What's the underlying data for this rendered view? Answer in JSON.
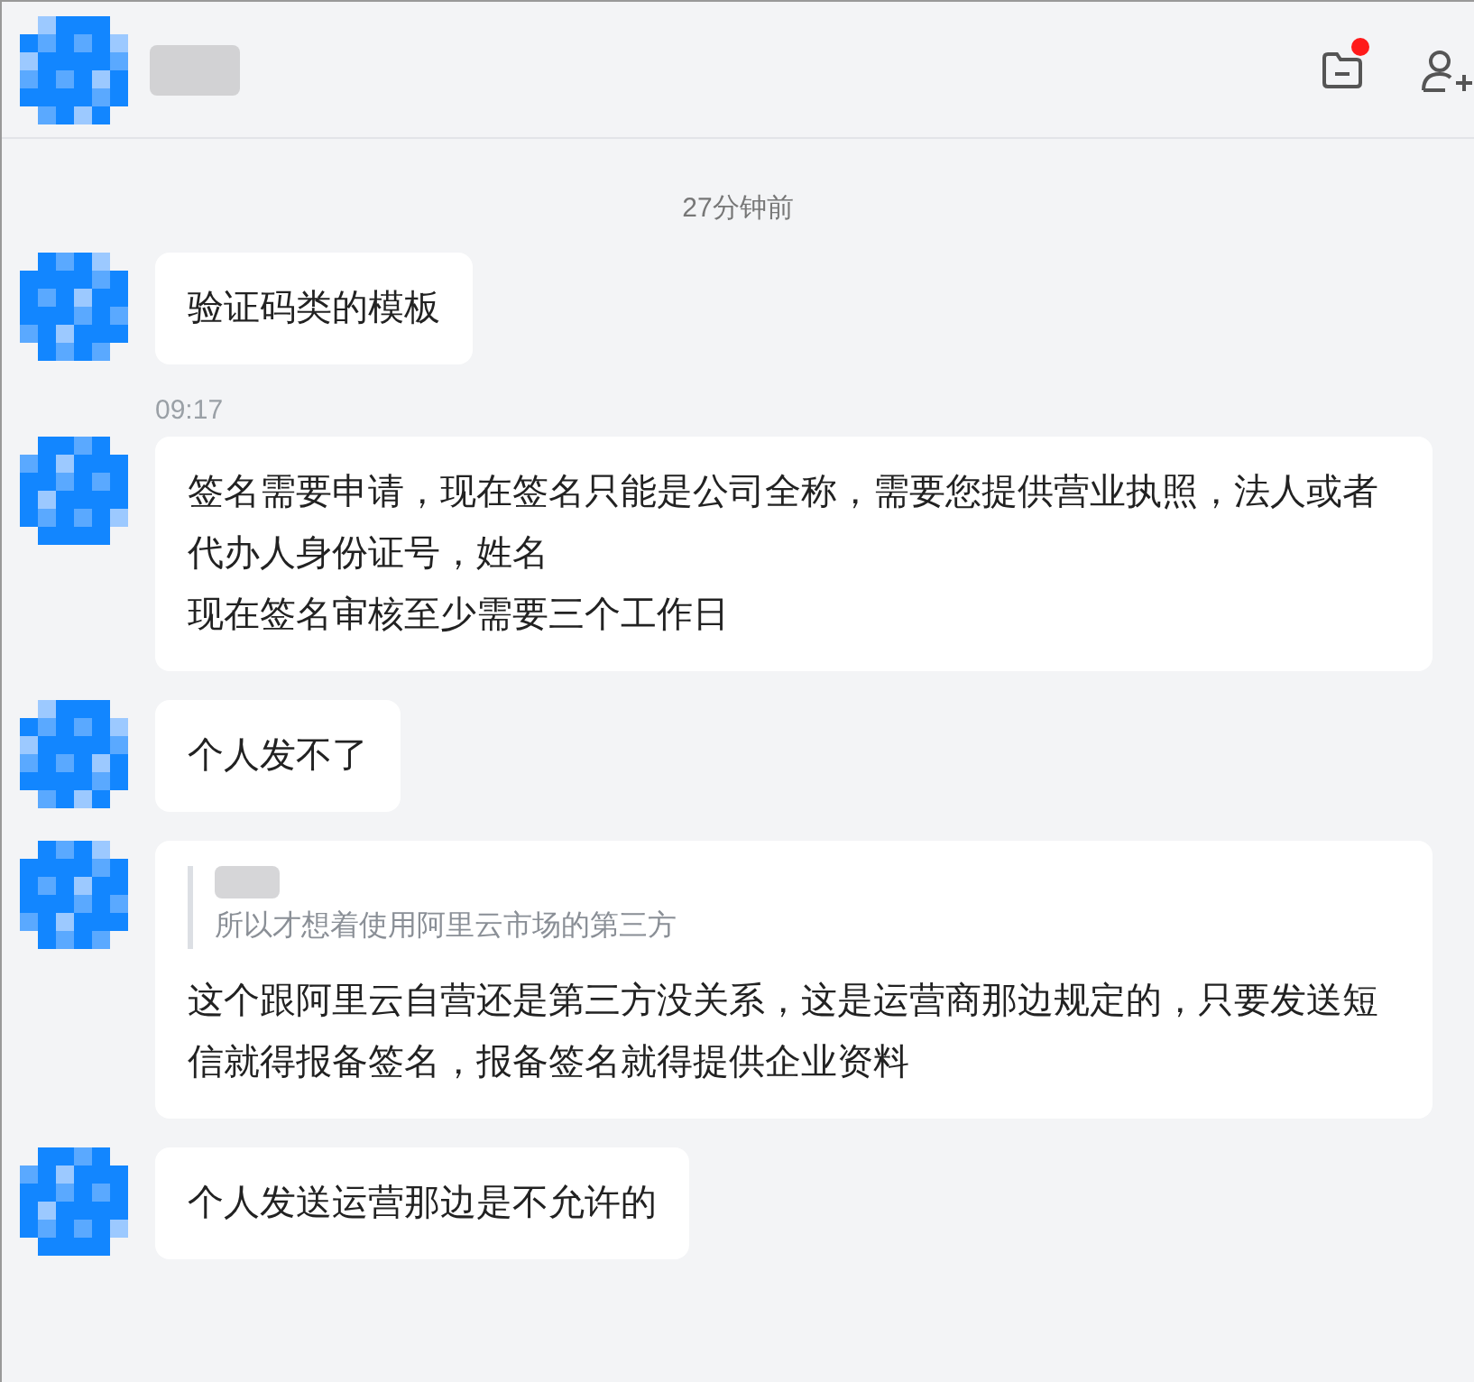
{
  "header": {
    "unread_dot": true
  },
  "divider_time": "27分钟前",
  "messages": [
    {
      "kind": "text",
      "paragraphs": [
        "验证码类的模板"
      ]
    },
    {
      "kind": "text",
      "time_before": "09:17",
      "paragraphs": [
        "签名需要申请，现在签名只能是公司全称，需要您提供营业执照，法人或者代办人身份证号，姓名",
        "现在签名审核至少需要三个工作日"
      ]
    },
    {
      "kind": "text",
      "paragraphs": [
        "个人发不了"
      ]
    },
    {
      "kind": "quote",
      "quote": "所以才想着使用阿里云市场的第三方",
      "paragraphs": [
        "这个跟阿里云自营还是第三方没关系，这是运营商那边规定的，只要发送短信就得报备签名，报备签名就得提供企业资料"
      ]
    },
    {
      "kind": "text",
      "paragraphs": [
        "个人发送运营那边是不允许的"
      ]
    }
  ]
}
